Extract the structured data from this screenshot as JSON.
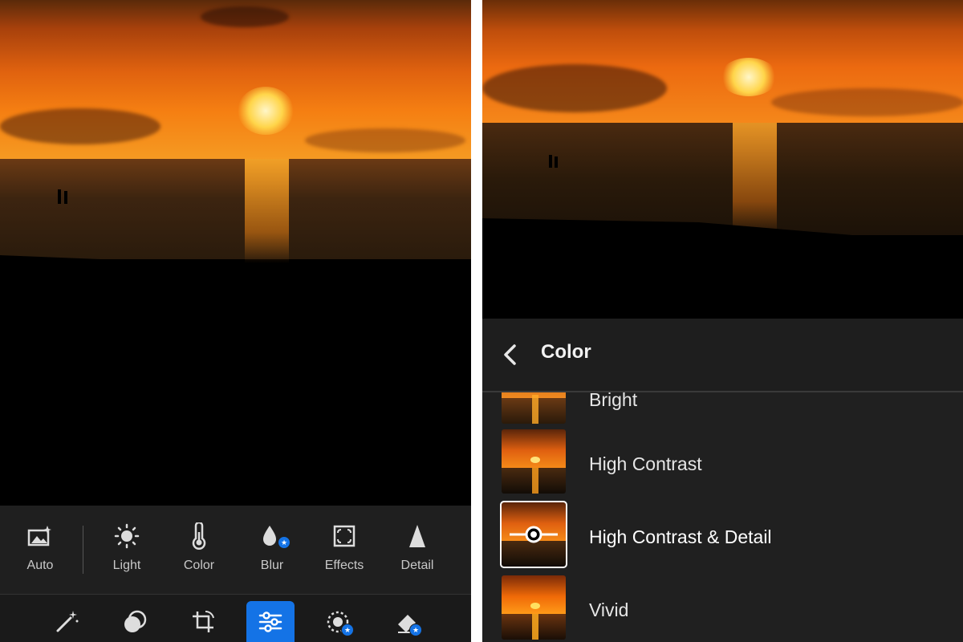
{
  "left_panel": {
    "toolbar": {
      "items": [
        {
          "label": "Auto",
          "icon": "auto-photo-icon"
        },
        {
          "label": "Light",
          "icon": "sun-icon"
        },
        {
          "label": "Color",
          "icon": "thermometer-icon"
        },
        {
          "label": "Blur",
          "icon": "blur-drop-icon",
          "premium": true
        },
        {
          "label": "Effects",
          "icon": "effects-frame-icon"
        },
        {
          "label": "Detail",
          "icon": "detail-triangle-icon"
        }
      ]
    },
    "bottom_bar": {
      "items": [
        {
          "icon": "magic-wand-icon",
          "active": false
        },
        {
          "icon": "masking-icon",
          "active": false
        },
        {
          "icon": "crop-icon",
          "active": false
        },
        {
          "icon": "sliders-icon",
          "active": true
        },
        {
          "icon": "selective-brush-icon",
          "active": false,
          "premium": true
        },
        {
          "icon": "healing-eraser-icon",
          "active": false,
          "premium": true
        }
      ]
    }
  },
  "right_panel": {
    "header": {
      "title": "Color",
      "back_icon": "chevron-left-icon"
    },
    "presets": [
      {
        "label": "Bright",
        "selected": false,
        "partial": true
      },
      {
        "label": "High Contrast",
        "selected": false
      },
      {
        "label": "High Contrast & Detail",
        "selected": true
      },
      {
        "label": "Vivid",
        "selected": false
      }
    ]
  },
  "colors": {
    "accent": "#1473e6",
    "toolbar_bg": "#1f1f1f",
    "list_bg": "#202020"
  }
}
